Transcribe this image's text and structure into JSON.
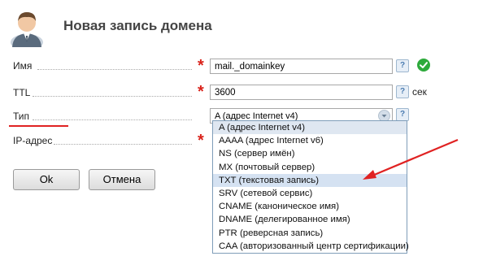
{
  "header": {
    "title": "Новая запись домена"
  },
  "form": {
    "name": {
      "label": "Имя",
      "value": "mail._domainkey",
      "required": true,
      "valid": true
    },
    "ttl": {
      "label": "TTL",
      "value": "3600",
      "unit": "сек",
      "required": true
    },
    "type": {
      "label": "Тип",
      "selected": "A (адрес Internet v4)"
    },
    "ip": {
      "label": "IP-адрес",
      "required": true
    }
  },
  "help_label": "?",
  "required_mark": "*",
  "buttons": {
    "ok": "Ok",
    "cancel": "Отмена"
  },
  "dropdown": {
    "options": [
      "A (адрес Internet v4)",
      "AAAA (адрес Internet v6)",
      "NS (сервер имён)",
      "MX (почтовый сервер)",
      "TXT (текстовая запись)",
      "SRV (сетевой сервис)",
      "CNAME (каноническое имя)",
      "DNAME (делегированное имя)",
      "PTR (реверсная запись)",
      "CAA (авторизованный центр сертификации)"
    ],
    "highlighted_index": 4
  },
  "annotation_color": "#e02222"
}
